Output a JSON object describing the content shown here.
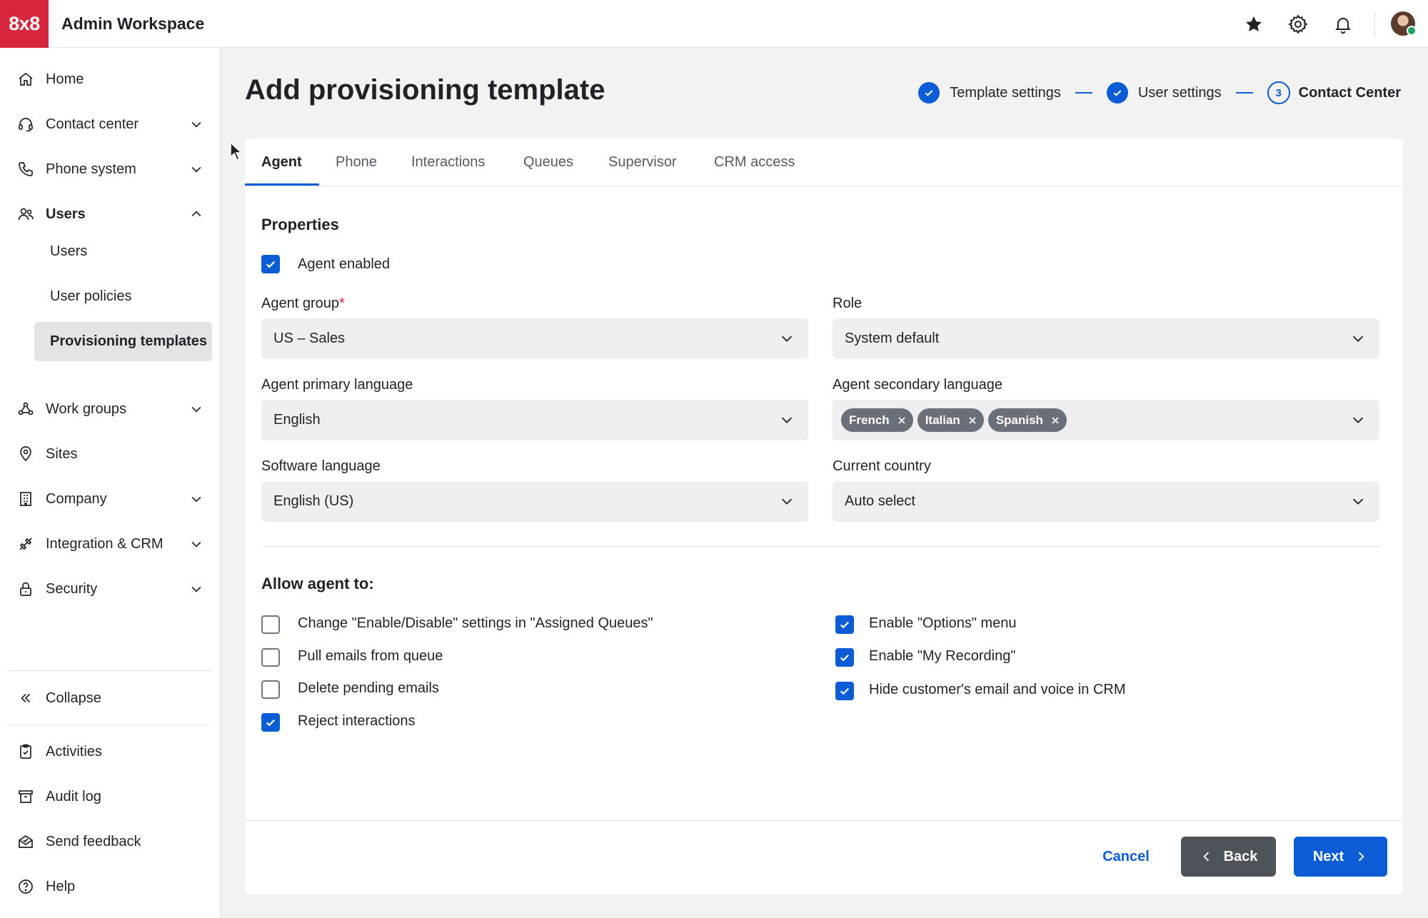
{
  "brand": {
    "logo_text": "8x8",
    "logo_color": "#d7263d",
    "accent": "#0b5cd5"
  },
  "header": {
    "app_title": "Admin Workspace",
    "icons": [
      "star-icon",
      "gear-icon",
      "bell-icon",
      "avatar"
    ]
  },
  "sidebar": {
    "items": [
      {
        "label": "Home",
        "icon": "home-icon"
      },
      {
        "label": "Contact center",
        "icon": "headset-icon"
      },
      {
        "label": "Phone system",
        "icon": "phone-icon"
      },
      {
        "label": "Users",
        "icon": "users-icon"
      },
      {
        "label": "Work groups",
        "icon": "workgroups-icon"
      },
      {
        "label": "Sites",
        "icon": "location-pin-icon"
      },
      {
        "label": "Company",
        "icon": "building-icon"
      },
      {
        "label": "Integration & CRM",
        "icon": "integration-icon"
      },
      {
        "label": "Security",
        "icon": "lock-icon"
      }
    ],
    "users_sub": [
      "Users",
      "User policies",
      "Provisioning templates"
    ],
    "collapse_label": "Collapse",
    "bottom": [
      {
        "label": "Activities",
        "icon": "clipboard-icon"
      },
      {
        "label": "Audit log",
        "icon": "archive-icon"
      },
      {
        "label": "Send feedback",
        "icon": "feedback-icon"
      },
      {
        "label": "Help",
        "icon": "help-icon"
      }
    ]
  },
  "page": {
    "title": "Add provisioning template",
    "steps": [
      {
        "label": "Template settings",
        "state": "done"
      },
      {
        "label": "User settings",
        "state": "done"
      },
      {
        "label": "Contact Center",
        "state": "current",
        "number": "3"
      }
    ]
  },
  "tabs": [
    "Agent",
    "Phone",
    "Interactions",
    "Queues",
    "Supervisor",
    "CRM access"
  ],
  "properties": {
    "title": "Properties",
    "agent_enabled_label": "Agent enabled",
    "agent_enabled": true,
    "agent_group_label": "Agent group",
    "agent_group_required": "*",
    "agent_group_value": "US – Sales",
    "role_label": "Role",
    "role_value": "System default",
    "primary_language_label": "Agent primary language",
    "primary_language_value": "English",
    "secondary_language_label": "Agent secondary language",
    "secondary_languages": [
      "French",
      "Italian",
      "Spanish"
    ],
    "software_language_label": "Software language",
    "software_language_value": "English (US)",
    "country_label": "Current country",
    "country_value": "Auto select"
  },
  "allow": {
    "title": "Allow agent to:",
    "left": [
      {
        "label": "Change \"Enable/Disable\" settings in \"Assigned Queues\"",
        "checked": false
      },
      {
        "label": "Pull emails from queue",
        "checked": false
      },
      {
        "label": "Delete pending emails",
        "checked": false
      },
      {
        "label": "Reject interactions",
        "checked": true
      }
    ],
    "right": [
      {
        "label": "Enable \"Options\" menu",
        "checked": true
      },
      {
        "label": "Enable \"My Recording\"",
        "checked": true
      },
      {
        "label": "Hide customer's email and voice in CRM",
        "checked": true
      }
    ]
  },
  "footer": {
    "cancel": "Cancel",
    "back": "Back",
    "next": "Next"
  }
}
